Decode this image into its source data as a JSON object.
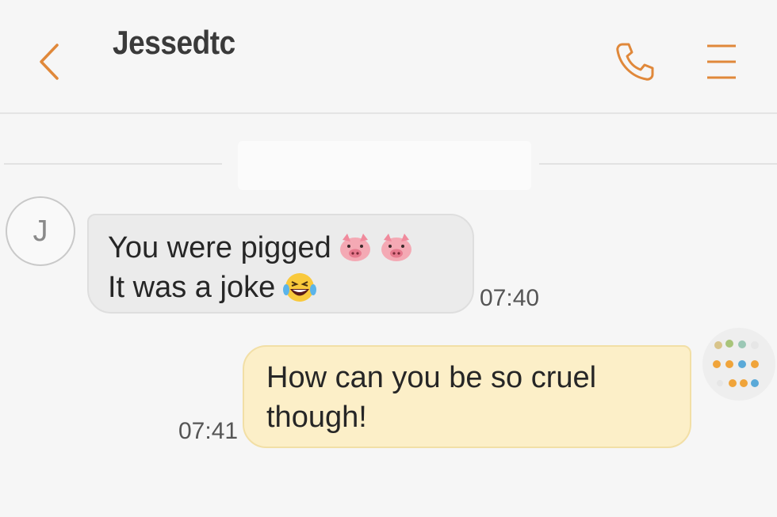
{
  "header": {
    "title": "Jessedtc",
    "back_icon": "chevron-left-icon",
    "call_icon": "phone-icon",
    "menu_icon": "menu-icon",
    "accent_color": "#e0883a"
  },
  "conversation": {
    "incoming": {
      "avatar_initial": "J",
      "lines": [
        "You were pigged",
        "It was a joke"
      ],
      "time": "07:40",
      "emoji_line1": [
        "pig-face-emoji",
        "pig-face-emoji"
      ],
      "emoji_line2": [
        "laughing-tears-emoji"
      ],
      "bubble_color": "#ebebeb"
    },
    "outgoing": {
      "lines": [
        "How can you be so cruel",
        "though!"
      ],
      "time": "07:41",
      "avatar_icon": "colored-dots-avatar",
      "bubble_color": "#fcefc8"
    }
  }
}
